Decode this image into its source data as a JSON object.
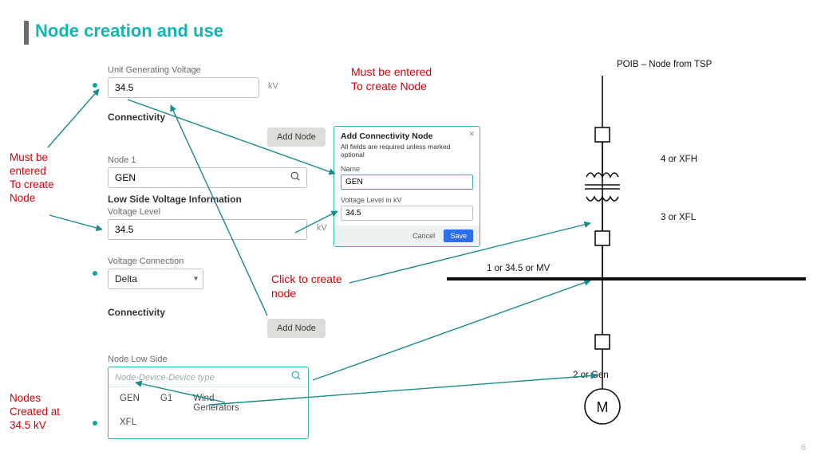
{
  "title": "Node creation and use",
  "page_number": "6",
  "annotations": {
    "must_be_entered_left": "Must be\nentered\nTo create\nNode",
    "must_be_entered_top": "Must be entered\nTo create Node",
    "click_to_create": "Click to create\nnode",
    "nodes_created": "Nodes\nCreated at\n34.5 kV"
  },
  "form": {
    "ugv_label": "Unit Generating Voltage",
    "ugv_value": "34.5",
    "ugv_unit": "kV",
    "connectivity_heading": "Connectivity",
    "add_node_label": "Add Node",
    "node1_label": "Node 1",
    "node1_value": "GEN",
    "lowside_heading": "Low Side Voltage Information",
    "voltage_level_label": "Voltage Level",
    "voltage_level_value": "34.5",
    "voltage_level_unit": "kV",
    "voltage_connection_label": "Voltage Connection",
    "voltage_connection_value": "Delta",
    "node_low_side_label": "Node Low Side",
    "node_low_side_placeholder": "Node-Device-Device type"
  },
  "dialog": {
    "title": "Add Connectivity Node",
    "subtitle": "All fields are required unless marked optional",
    "name_label": "Name",
    "name_value": "GEN",
    "voltage_label": "Voltage Level in kV",
    "voltage_value": "34.5",
    "cancel": "Cancel",
    "save": "Save"
  },
  "dropdown": {
    "opt1": "GEN",
    "opt2": "G1",
    "opt3": "Wind\nGenerators",
    "opt4": "XFL"
  },
  "diagram": {
    "poib": "POIB – Node from TSP",
    "lbl_4": "4 or XFH",
    "lbl_3": "3 or XFL",
    "lbl_1": "1 or 34.5 or MV",
    "lbl_2": "2 or Gen",
    "motor": "M"
  }
}
